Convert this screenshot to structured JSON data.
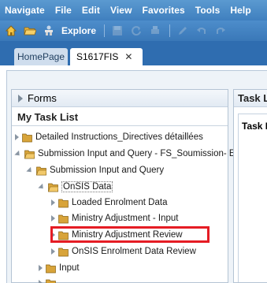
{
  "menu": {
    "items": [
      "Navigate",
      "File",
      "Edit",
      "View",
      "Favorites",
      "Tools",
      "Help"
    ]
  },
  "toolbar": {
    "explore_label": "Explore",
    "icons": [
      "home-icon",
      "folder-open-icon",
      "explore-icon",
      "save-icon",
      "refresh-icon",
      "print-icon",
      "edit-icon",
      "undo-icon",
      "redo-icon"
    ]
  },
  "tabs": {
    "home_label": "HomePage",
    "active_label": "S1617FIS",
    "close_glyph": "✕"
  },
  "left_panel": {
    "forms_label": "Forms",
    "tasklist_title": "My Task List",
    "tree": [
      {
        "label": "Detailed Instructions_Directives détaillées"
      },
      {
        "label": "Submission Input and Query - FS_Soumission- Er"
      },
      {
        "label": "Submission Input and Query"
      },
      {
        "label": "OnSIS Data"
      },
      {
        "label": "Loaded Enrolment Data"
      },
      {
        "label": "Ministry Adjustment - Input"
      },
      {
        "label": "Ministry Adjustment Review"
      },
      {
        "label": "OnSIS Enrolment Data Review"
      },
      {
        "label": "Input"
      }
    ]
  },
  "right_panel": {
    "header": "Task Li",
    "inner_title": "Task L"
  },
  "colors": {
    "menubar": "#4a8bc7",
    "tabstrip": "#2f6db0",
    "highlight": "#e51c24",
    "folder": "#c8962e"
  }
}
